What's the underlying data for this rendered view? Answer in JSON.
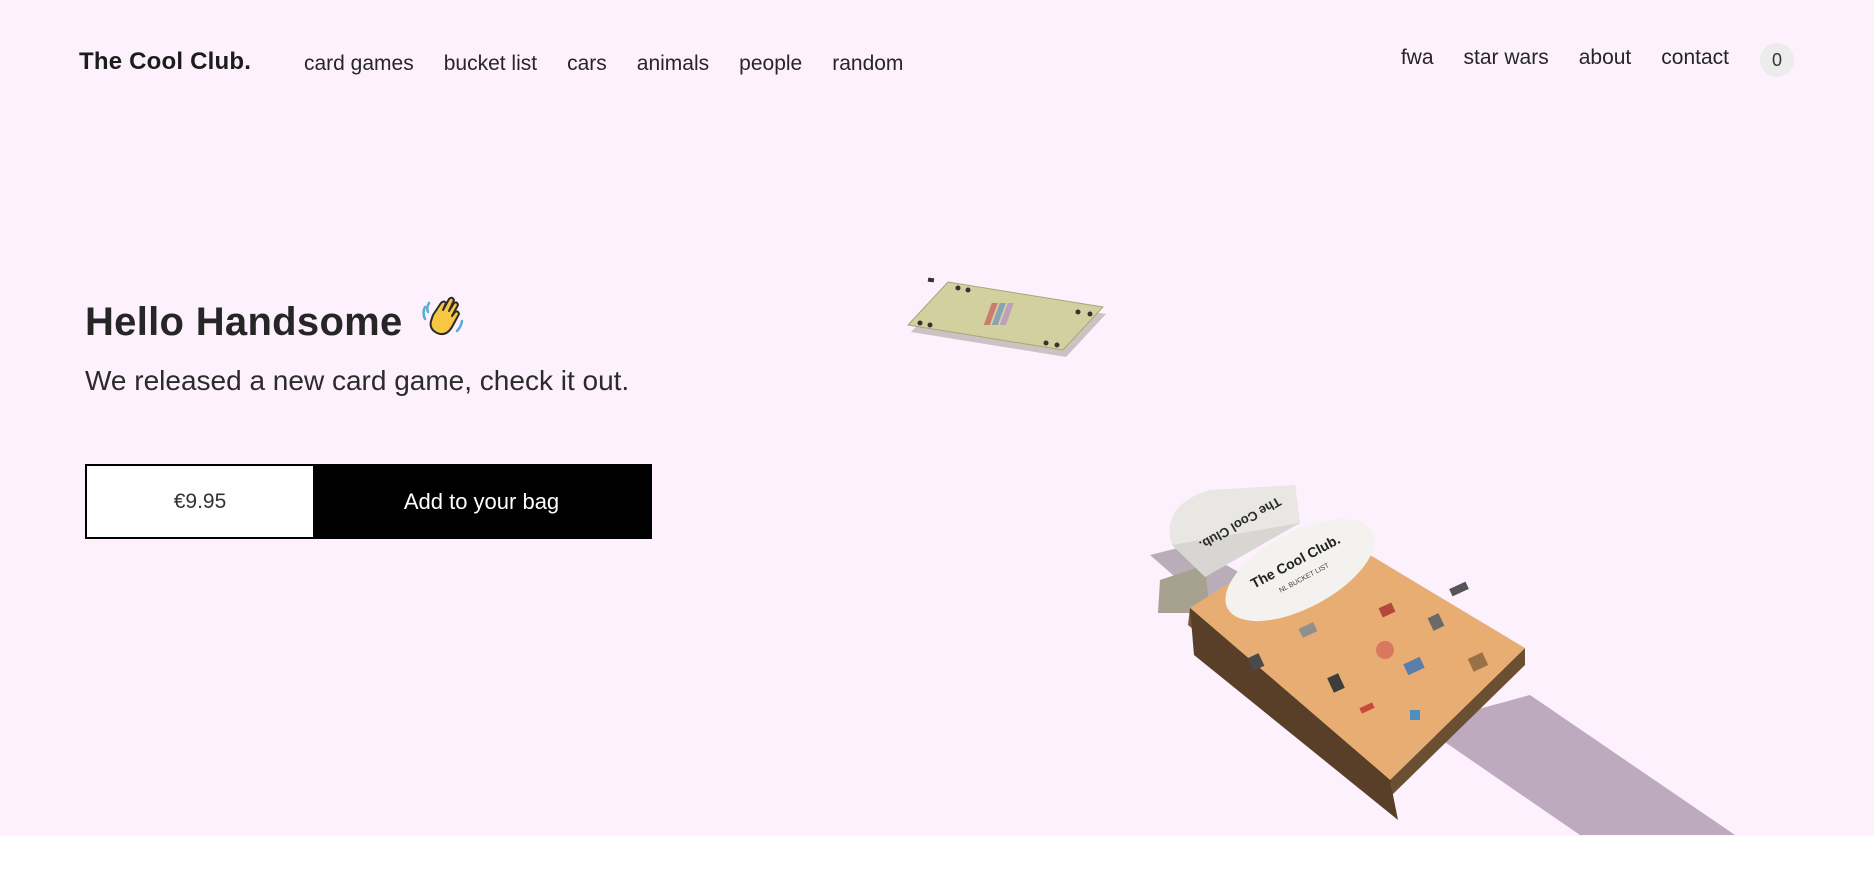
{
  "header": {
    "logo": "The Cool Club.",
    "nav_left": [
      "card games",
      "bucket list",
      "cars",
      "animals",
      "people",
      "random"
    ],
    "nav_right": [
      "fwa",
      "star wars",
      "about",
      "contact"
    ],
    "bag_count": "0"
  },
  "hero": {
    "title": "Hello Handsome",
    "title_emoji": "waving-hand-icon",
    "subtitle": "We released a new card game, check it out.",
    "price": "€9.95",
    "cta": "Add to your bag"
  },
  "product_box": {
    "brand": "The Cool Club.",
    "edition": "NL BUCKET LIST",
    "lid_text": "The Cool Club."
  },
  "colors": {
    "background": "#fdf1fd",
    "accent": "#000000",
    "box": "#e8ad73",
    "card": "#d2cf9c"
  }
}
